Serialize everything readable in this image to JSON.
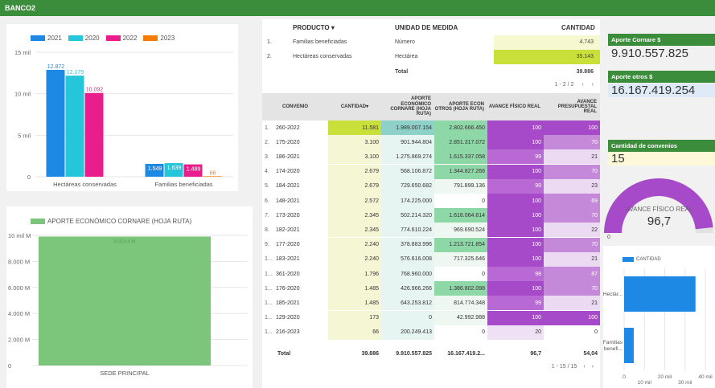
{
  "title": "BANCO2",
  "left_chart": {
    "legend": [
      {
        "label": "2021",
        "color": "#1e88e5"
      },
      {
        "label": "2020",
        "color": "#26c6da"
      },
      {
        "label": "2022",
        "color": "#e91e8c"
      },
      {
        "label": "2023",
        "color": "#f57c00"
      }
    ],
    "y_ticks": [
      "15 mil",
      "10 mil",
      "5 mil",
      "0"
    ],
    "categories": [
      "Hectáreas conservadas",
      "Familias beneficiadas"
    ],
    "groups": [
      {
        "values": [
          12872,
          12179,
          10092,
          0
        ],
        "labels": [
          "12.872",
          "12.179",
          "10.092",
          ""
        ]
      },
      {
        "values": [
          1549,
          1639,
          1489,
          66
        ],
        "labels": [
          "1.549",
          "1.639",
          "1.489",
          "66"
        ]
      }
    ]
  },
  "bottom_chart": {
    "legend": "APORTE ECONÓMICO CORNARE (HOJA RUTA)",
    "y_ticks": [
      "10 mil M",
      "8.000 M",
      "6.000 M",
      "4.000 M",
      "2.000 M",
      "0"
    ],
    "category": "SEDE PRINCIPAL",
    "value": 9910557825,
    "value_label": "9.910,6 M",
    "color": "#7bc67b"
  },
  "product_table": {
    "headers": [
      "PRODUCTO",
      "UNIDAD DE MEDIDA",
      "CANTIDAD"
    ],
    "rows": [
      {
        "n": "1.",
        "producto": "Familias beneficiadas",
        "unidad": "Número",
        "cantidad": "4.743"
      },
      {
        "n": "2.",
        "producto": "Hectáreas conservadas",
        "unidad": "Hectárea",
        "cantidad": "35.143"
      }
    ],
    "total_label": "Total",
    "total_value": "39.886",
    "pager": "1 - 2 / 2"
  },
  "main_table": {
    "headers": [
      "CONVENIO",
      "CANTIDAD",
      "APORTE ECONÓMICO CORNARE (HOJA RUTA)",
      "APORTE ECON OTROS (HOJA RUTA)",
      "AVANCE FÍSICO REAL",
      "AVANCE PRESUPUESTAL REAL"
    ],
    "rows": [
      [
        "1.",
        "260-2022",
        "11.581",
        "1.989.007.154",
        "2.802.666.450",
        "100",
        "100"
      ],
      [
        "2.",
        "175-2020",
        "3.100",
        "901.944.804",
        "2.851.317.072",
        "100",
        "70"
      ],
      [
        "3.",
        "186-2021",
        "3.100",
        "1.275.869.274",
        "1.615.337.058",
        "99",
        "21"
      ],
      [
        "4.",
        "174-2020",
        "2.679",
        "568.106.872",
        "1.344.827.266",
        "100",
        "70"
      ],
      [
        "5.",
        "184-2021",
        "2.679",
        "729.650.682",
        "791.899.136",
        "99",
        "23"
      ],
      [
        "6.",
        "148-2021",
        "2.572",
        "174.225.000",
        "0",
        "100",
        "69"
      ],
      [
        "7.",
        "173-2020",
        "2.345",
        "502.214.320",
        "1.616.064.614",
        "100",
        "70"
      ],
      [
        "8.",
        "182-2021",
        "2.345",
        "774.610.224",
        "969.690.524",
        "100",
        "22"
      ],
      [
        "9.",
        "177-2020",
        "2.240",
        "378.883.996",
        "1.213.721.854",
        "100",
        "70"
      ],
      [
        "1...",
        "183-2021",
        "2.240",
        "576.616.008",
        "717.325.646",
        "100",
        "21"
      ],
      [
        "1...",
        "361-2020",
        "1.796",
        "768.960.000",
        "0",
        "98",
        "87"
      ],
      [
        "1...",
        "176-2020",
        "1.485",
        "426.966.266",
        "1.386.802.098",
        "100",
        "70"
      ],
      [
        "1...",
        "185-2021",
        "1.485",
        "643.253.812",
        "814.774.348",
        "99",
        "21"
      ],
      [
        "1...",
        "129-2020",
        "173",
        "0",
        "42.992.988",
        "100",
        "100"
      ],
      [
        "1...",
        "216-2023",
        "66",
        "200.249.413",
        "0",
        "20",
        "0"
      ]
    ],
    "total": [
      "Total",
      "39.886",
      "9.910.557.825",
      "16.167.419.2...",
      "96,7",
      "54,04"
    ],
    "pager": "1 - 15 / 15"
  },
  "kpis": [
    {
      "title": "Aporte Cornare $",
      "value": "9.910.557.825"
    },
    {
      "title": "Aporte otros $",
      "value": "16.167.419.254"
    },
    {
      "title": "Cantidad de convenios",
      "value": "15"
    }
  ],
  "gauge": {
    "title": "AVANCE FÍSICO REAL",
    "value": "96,7",
    "min": "0",
    "color": "#a64ac9"
  },
  "right_bar": {
    "legend": "CANTIDAD",
    "categories": [
      "Hectár...",
      "Familias benefi..."
    ],
    "values": [
      35143,
      4743
    ],
    "x_ticks": [
      "0",
      "10 mil",
      "20 mil",
      "30 mil",
      "40 mil"
    ],
    "color": "#1e88e5"
  }
}
